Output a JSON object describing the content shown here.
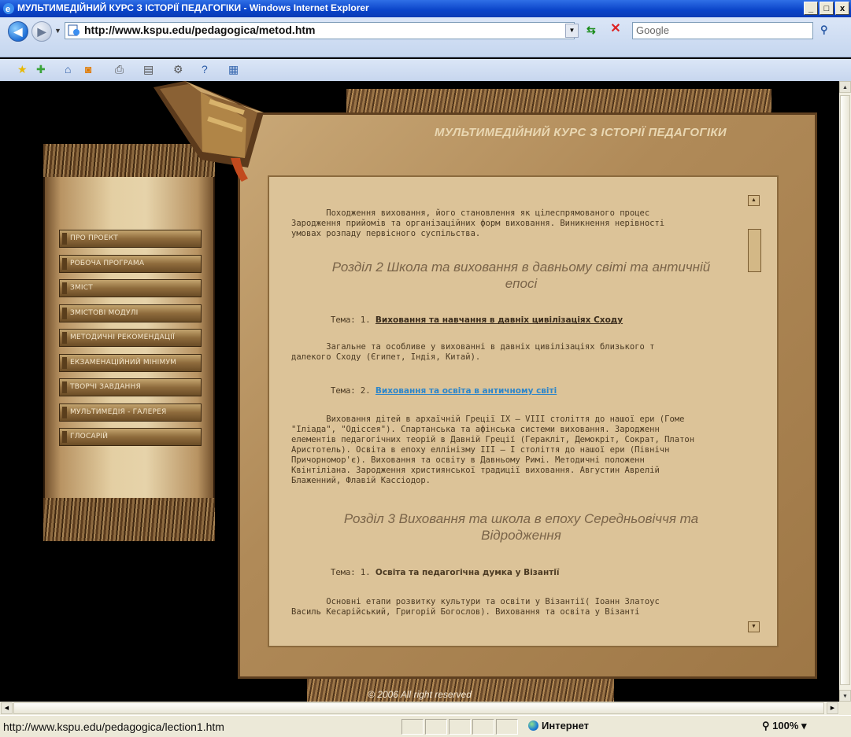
{
  "window": {
    "title": "МУЛЬТИМЕДІЙНИЙ КУРС З ІСТОРІЇ ПЕДАГОГІКИ - Windows Internet Explorer",
    "buttons": [
      "_",
      "□",
      "x"
    ]
  },
  "address": {
    "url": "http://www.kspu.edu/pedagogica/metod.htm",
    "search_placeholder": "Google"
  },
  "page": {
    "site_title": "МУЛЬТИМЕДІЙНИЙ КУРС З ІСТОРІЇ ПЕДАГОГІКИ",
    "menu": [
      {
        "label": "ПРО ПРОЕКТ"
      },
      {
        "label": "РОБОЧА ПРОГРАМА"
      },
      {
        "label": "ЗМІСТ"
      },
      {
        "label": "ЗМІСТОВІ МОДУЛІ"
      },
      {
        "label": "МЕТОДИЧНІ РЕКОМЕНДАЦІЇ"
      },
      {
        "label": "ЕКЗАМЕНАЦІЙНИЙ МІНІМУМ"
      },
      {
        "label": "ТВОРЧІ ЗАВДАННЯ"
      },
      {
        "label": "МУЛЬТИМЕДІЯ - ГАЛЕРЕЯ"
      },
      {
        "label": "ГЛОСАРІЙ"
      }
    ],
    "intro_para": "       Походження виховання, його становлення як цілеспрямованого процес\nЗародження прийомів та організаційних форм виховання. Виникнення нерівності\nумовах розпаду первісного суспільства.",
    "section2": "Розділ 2 Школа та виховання в давньому світі та античній епосі",
    "topic2_1_prefix": "Тема: 1.",
    "topic2_1_link": "Виховання та навчання в давніх цивілізаціях Сходу",
    "para2_1": "       Загальне та особливе у вихованні в давніх цивілізаціях близького т\nдалекого Сходу (Єгипет, Індія, Китай).",
    "topic2_2_prefix": "Тема: 2.",
    "topic2_2_link": "Виховання та освіта в античному світі",
    "para2_2": "       Виховання дітей в архаїчній Греції IX – VIII століття до нашої ери (Гоме\n\"Іліада\", \"Одіссея\"). Спартанська та афінська системи виховання. Зародженн\nелементів педагогічних теорій в Давній Греції (Геракліт, Демокріт, Сократ, Платон\nАристотель). Освіта в епоху еллінізму III – I століття до нашої ери (Північн\nПричорномор'є). Виховання та освіту в Давньому Римі. Методичні положенн\nКвінтіліана. Зародження християнської традиції виховання. Августин Аврелій\nБлаженний, Флавій Кассіодор.",
    "section3": "Розділ 3 Виховання та школа в епоху Середньовіччя та Відродження",
    "topic3_1_prefix": "Тема: 1.",
    "topic3_1_title": "Освіта та педагогічна думка у Візантії",
    "para3_1": "       Основні етапи розвитку культури та освіти у Візантії( Іоанн Златоус\nВасиль Кесарійський, Григорій Богослов). Виховання та освіта у Візанті",
    "copyright": "© 2006 All right reserved"
  },
  "status": {
    "url": "http://www.kspu.edu/pedagogica/lection1.htm",
    "zone": "Интернет",
    "zoom": "100%"
  },
  "colors": {
    "titlebar": "#0a43c8",
    "link_active": "#2e86c9",
    "content_bg": "#dcc398"
  }
}
